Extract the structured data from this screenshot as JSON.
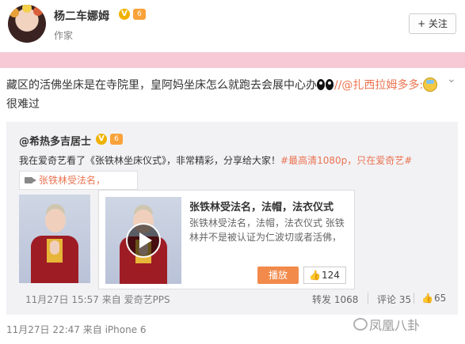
{
  "header": {
    "username": "杨二车娜姆",
    "verified_badge": "V",
    "level_badge": "6",
    "user_title": "作家",
    "follow_label": "+ 关注"
  },
  "post": {
    "text_main": "藏区的活佛坐床是在寺院里，皇阿妈坐床怎么就跑去会展中心办",
    "mention": "//@扎西拉姆多多:",
    "text_tail": "很难过"
  },
  "repost": {
    "author": "@希热多吉居士",
    "text_prefix": "我在爱奇艺看了《张铁林坐床仪式》，非常精彩，分享给大家！",
    "hashtag": "#最高清1080p，只在爱奇艺#",
    "video_tag": "张铁林受法名，",
    "card": {
      "title": "张铁林受法名，法帽，法衣仪式",
      "description": "张铁林受法名，法帽，法衣仪式 张铁林并不是被认证为仁波切或者活佛，",
      "play_label": "播放",
      "like_icon": "thumb-up-icon",
      "like_count": "124"
    },
    "meta": "11月27日 15:57 来自 爱奇艺PPS",
    "stats": {
      "repost": "转发 1068",
      "comment": "评论 35",
      "like": "65"
    }
  },
  "footer": {
    "meta": "11月27日 22:47 来自 iPhone 6",
    "watermark": "凤凰八卦"
  },
  "colors": {
    "accent": "#eb7350",
    "banner": "#f7c9d7",
    "repost_bg": "#f2f2f5",
    "play_button": "#f28a4b"
  }
}
